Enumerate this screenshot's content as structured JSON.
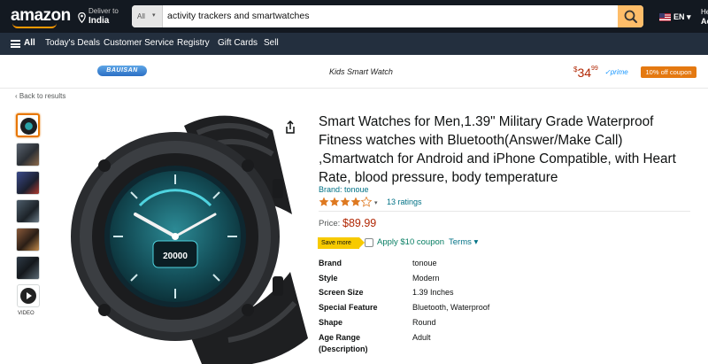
{
  "header": {
    "logo": "amazon",
    "deliver_small": "Deliver to",
    "deliver_big": "India",
    "search_category": "All",
    "search_value": "activity trackers and smartwatches",
    "lang": "EN",
    "account_small": "Hello,",
    "account_big": "Ac"
  },
  "navbar": {
    "all": "All",
    "items": [
      "Today's Deals",
      "Customer Service",
      "Registry",
      "Gift Cards",
      "Sell"
    ]
  },
  "banner": {
    "brand": "BAUISAN",
    "title": "Kids Smart Watch",
    "price_symbol": "$",
    "price_whole": "34",
    "price_fraction": "99",
    "prime": "prime",
    "coupon": "10% off coupon"
  },
  "back_link": "‹ Back to results",
  "video_label": "VIDEO",
  "product": {
    "title": "Smart Watches for Men,1.39\" Military Grade Waterproof Fitness watches with Bluetooth(Answer/Make Call) ,Smartwatch for Android and iPhone Compatible, with Heart Rate, blood pressure, body temperature",
    "brand_link": "Brand: tonoue",
    "rating": 4,
    "ratings_count": "13 ratings",
    "price_label": "Price:",
    "price": "$89.99",
    "save_badge": "Save more",
    "coupon_text": "Apply $10 coupon",
    "terms": "Terms",
    "watch_face_steps": "20000"
  },
  "specs": [
    {
      "key": "Brand",
      "value": "tonoue"
    },
    {
      "key": "Style",
      "value": "Modern"
    },
    {
      "key": "Screen Size",
      "value": "1.39 Inches"
    },
    {
      "key": "Special Feature",
      "value": "Bluetooth, Waterproof"
    },
    {
      "key": "Shape",
      "value": "Round"
    },
    {
      "key": "Age Range",
      "value": "Adult"
    },
    {
      "key": "(Description)",
      "value": ""
    }
  ],
  "colors": {
    "nav_dark": "#131921",
    "nav_light": "#232f3e",
    "link": "#007185",
    "price": "#b12704",
    "accent": "#febd69"
  }
}
